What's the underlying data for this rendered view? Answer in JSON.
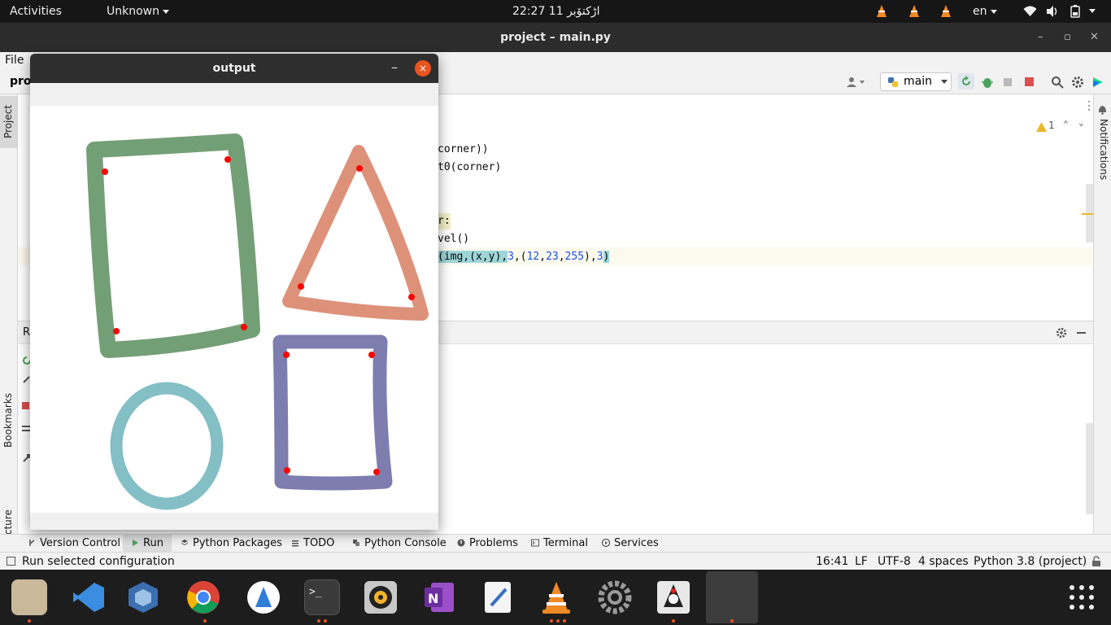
{
  "topbar": {
    "activities": "Activities",
    "app_menu": "Unknown",
    "clock": "22:27  11 اڑکتۆبر",
    "language": "en"
  },
  "ide_window": {
    "title": "project – main.py",
    "menu_file": "File",
    "project_label": "proj",
    "run_config": "main",
    "warnings_count": "1",
    "notifications_tab": "Notifications",
    "project_tab": "Project",
    "bookmarks_tab": "Bookmarks",
    "structure_tab": "Structure",
    "run_panel_label": "R",
    "code": {
      "line1": "corner))",
      "line2": "t0(corner)",
      "line3": "r:",
      "line4": "vel()",
      "line5_a": "(img,(x,y),",
      "line5_b": "3",
      "line5_c": ",(",
      "line5_d": "12",
      "line5_e": ",",
      "line5_f": "23",
      "line5_g": ",",
      "line5_h": "255",
      "line5_i": "),",
      "line5_j": "3",
      "line5_k": ")"
    },
    "bottom_tabs": [
      "Version Control",
      "Run",
      "Python Packages",
      "TODO",
      "Python Console",
      "Problems",
      "Terminal",
      "Services"
    ],
    "status": {
      "message": "Run selected configuration",
      "position": "16:41",
      "line_sep": "LF",
      "encoding": "UTF-8",
      "indent": "4 spaces",
      "interpreter": "Python 3.8 (project)"
    }
  },
  "output_window": {
    "title": "output",
    "minimize": "–",
    "close": "×"
  },
  "colors": {
    "green_shape": "#6b9a6f",
    "orange_shape": "#dc8b72",
    "teal_shape": "#7cbcc2",
    "purple_shape": "#7677ab",
    "corner_dot": "#ff0000",
    "accent": "#e95420"
  },
  "dock": {
    "apps": [
      "files-icon",
      "vscode-icon",
      "virtualbox-icon",
      "chrome-icon",
      "ide-icon",
      "terminal-icon",
      "rhythmbox-icon",
      "onenote-icon",
      "text-editor-icon",
      "vlc-icon",
      "settings-icon",
      "java-icon",
      "active-window-icon"
    ]
  }
}
